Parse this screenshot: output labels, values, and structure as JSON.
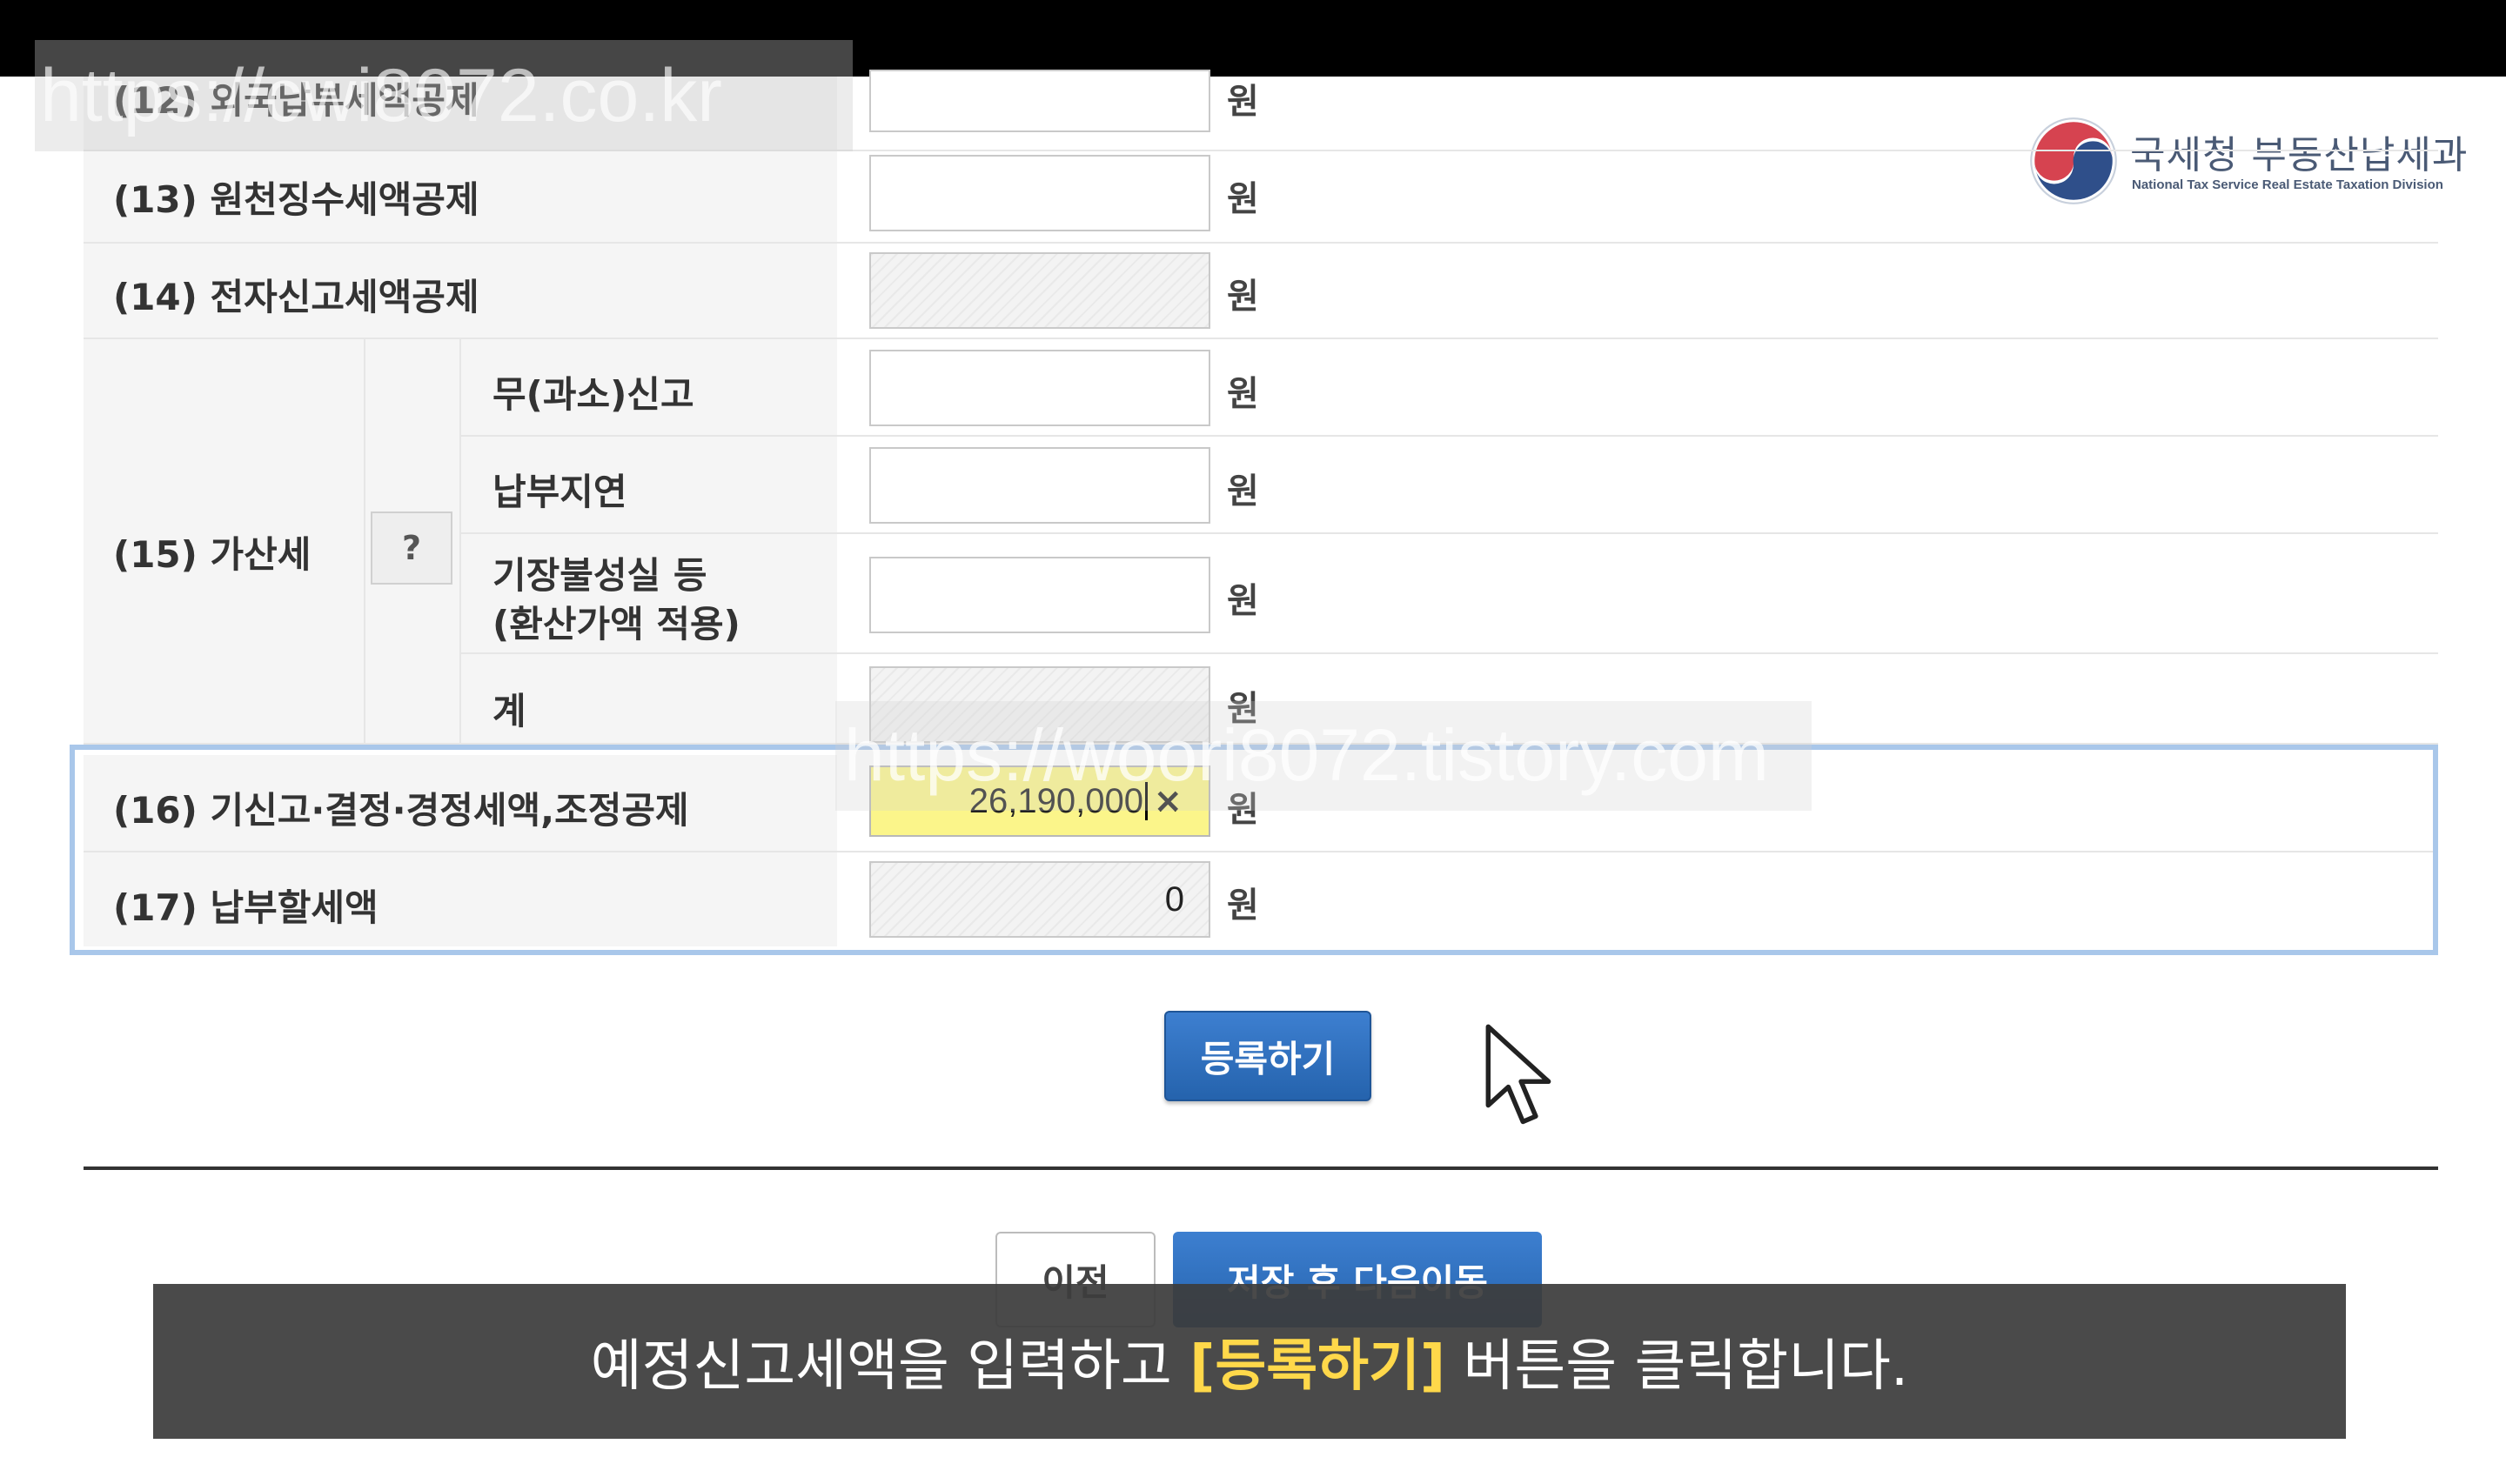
{
  "watermarks": {
    "top_left": "https://cwi8072.co.kr",
    "middle": "https://woori8072.tistory.com"
  },
  "logo": {
    "title_ko": "국세청 부동산납세과",
    "title_en": "National Tax Service Real Estate Taxation Division"
  },
  "form": {
    "unit": "원",
    "rows": {
      "r12": {
        "label": "(12) 외국납부세액공제",
        "value": ""
      },
      "r13": {
        "label": "(13) 원천징수세액공제",
        "value": ""
      },
      "r14": {
        "label": "(14) 전자신고세액공제",
        "value": "",
        "disabled": true
      },
      "r15": {
        "label": "(15) 가산세",
        "help": "?",
        "sub": {
          "a": {
            "label": "무(과소)신고",
            "value": ""
          },
          "b": {
            "label": "납부지연",
            "value": ""
          },
          "c": {
            "label_line1": "기장불성실 등",
            "label_line2": "(환산가액 적용)",
            "value": ""
          },
          "d": {
            "label": "계",
            "value": "",
            "disabled": true
          }
        }
      },
      "r16": {
        "label": "(16) 기신고·결정·경정세액,조정공제",
        "value": "26,190,000",
        "clear": "×",
        "focused": true
      },
      "r17": {
        "label": "(17) 납부할세액",
        "value": "0",
        "disabled": true
      }
    }
  },
  "buttons": {
    "register": "등록하기",
    "prev": "이전",
    "save_next": "저장 후 다음이동"
  },
  "subtitle": {
    "before": "예정신고세액을 입력하고 ",
    "highlight": "[등록하기]",
    "after": " 버튼을 클릭합니다."
  },
  "colors": {
    "highlight_border": "#a9c7ea",
    "button_blue": "#2f6fbf",
    "focused_input": "#fbf58a",
    "subtitle_highlight": "#ffd84a"
  }
}
